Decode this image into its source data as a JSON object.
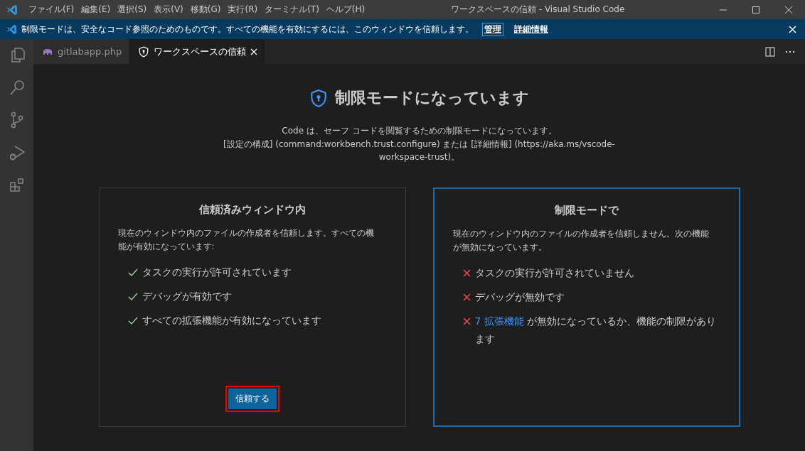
{
  "menu": [
    "ファイル(F)",
    "編集(E)",
    "選択(S)",
    "表示(V)",
    "移動(G)",
    "実行(R)",
    "ターミナル(T)",
    "ヘルプ(H)"
  ],
  "window": {
    "title": "ワークスペースの信頼 - Visual Studio Code"
  },
  "banner": {
    "message": "制限モードは、安全なコード参照のためのものです。すべての機能を有効にするには、このウィンドウを信頼します。",
    "links": [
      {
        "label": "管理",
        "focused": true
      },
      {
        "label": "詳細情報",
        "focused": false
      }
    ]
  },
  "activity_bar": [
    {
      "kind": "explorer"
    },
    {
      "kind": "search"
    },
    {
      "kind": "scm"
    },
    {
      "kind": "debug"
    },
    {
      "kind": "extensions"
    }
  ],
  "tabs": [
    {
      "label": "gitlabapp.php",
      "kind": "php",
      "selected": false
    },
    {
      "label": "ワークスペースの信頼",
      "kind": "trust",
      "selected": true
    }
  ],
  "page": {
    "title": "制限モードになっています",
    "description": [
      "Code は、セーフ コードを閲覧するための制限モードになっています。",
      "[設定の構成] (command:workbench.trust.configure) または [詳細情報] (https://aka.ms/vscode-workspace-trust)。"
    ]
  },
  "cards": [
    {
      "kind": "trusted",
      "current": false,
      "title": "信頼済みウィンドウ内",
      "description": "現在のウィンドウ内のファイルの作成者を信頼します。すべての機能が有効になっています:",
      "features": [
        {
          "text": "タスクの実行が許可されています"
        },
        {
          "text": "デバッグが有効です"
        },
        {
          "text": "すべての拡張機能が有効になっています"
        }
      ],
      "button": {
        "label": "信頼する",
        "outlined": true
      }
    },
    {
      "kind": "restricted",
      "current": true,
      "title": "制限モードで",
      "description": "現在のウィンドウ内のファイルの作成者を信頼しません。次の機能が無効になっています。",
      "features": [
        {
          "text": "タスクの実行が許可されていません"
        },
        {
          "text": "デバッグが無効です"
        },
        {
          "link": "7 拡張機能",
          "text": " が無効になっているか、機能の制限があります"
        }
      ]
    }
  ]
}
